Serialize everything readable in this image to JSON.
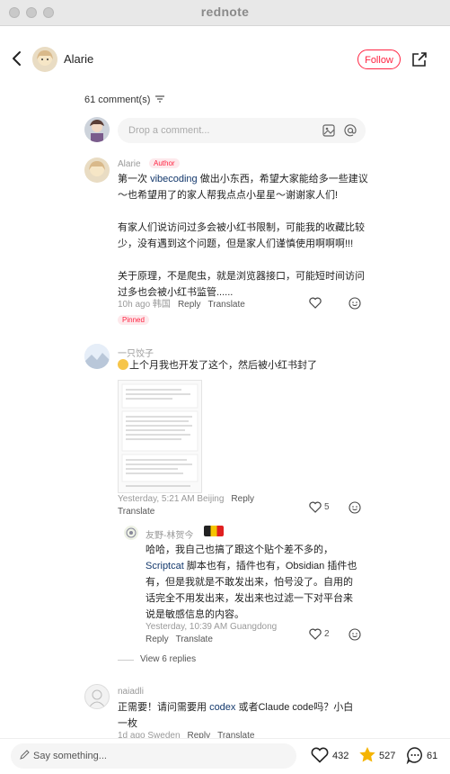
{
  "window": {
    "title": "rednote"
  },
  "header": {
    "user": "Alarie",
    "follow_label": "Follow"
  },
  "comments_header": {
    "count": "61 comment(s)",
    "input_placeholder": "Drop a comment..."
  },
  "comments": [
    {
      "user": "Alarie",
      "badge": "Author",
      "p1_pre": "第一次 ",
      "p1_link": "vibecoding",
      "p1_post": " 做出小东西，希望大家能给多一些建议～也希望用了的家人帮我点点小星星～谢谢家人们!",
      "p2": "有家人们说访问过多会被小红书限制，可能我的收藏比较少，没有遇到这个问题，但是家人们谨慎使用啊啊啊!!!",
      "p3": "关于原理，不是爬虫，就是浏览器接口，可能短时间访问过多也会被小红书监管......",
      "meta": "10h ago 韩国",
      "reply": "Reply",
      "translate": "Translate",
      "pinned": "Pinned"
    },
    {
      "user": "一只饺子",
      "text": "上个月我也开发了这个，然后被小红书封了",
      "meta": "Yesterday, 5:21 AM Beijing",
      "reply": "Reply",
      "translate": "Translate",
      "likes": "5"
    },
    {
      "user": "友野-林贺今",
      "text_pre": "哈哈，我自己也搞了跟这个贴个差不多的，",
      "text_link": "Scriptcat",
      "text_post": " 脚本也有，插件也有，Obsidian 插件也有，但是我就是不敢发出来，怕号没了。自用的话完全不用发出来，发出来也过滤一下对平台来说是敏感信息的内容。",
      "meta": "Yesterday, 10:39 AM Guangdong",
      "reply": "Reply",
      "translate": "Translate",
      "likes": "2",
      "view_replies": "View 6 replies"
    },
    {
      "user": "naiadli",
      "text_pre": "正需要！请问需要用 ",
      "text_link": "codex",
      "text_post": " 或者Claude code吗？小白一枚",
      "meta": "1d ago Sweden",
      "reply": "Reply",
      "translate": "Translate"
    }
  ],
  "footer": {
    "placeholder": "Say something...",
    "likes": "432",
    "stars": "527",
    "comments": "61"
  },
  "colors": {
    "accent": "#ff2442",
    "link": "#13386c",
    "star": "#f5b400"
  },
  "icons": [
    "back-icon",
    "share-icon",
    "filter-icon",
    "image-icon",
    "at-icon",
    "heart-icon",
    "emoji-icon",
    "star-icon",
    "comment-icon",
    "pencil-icon"
  ]
}
